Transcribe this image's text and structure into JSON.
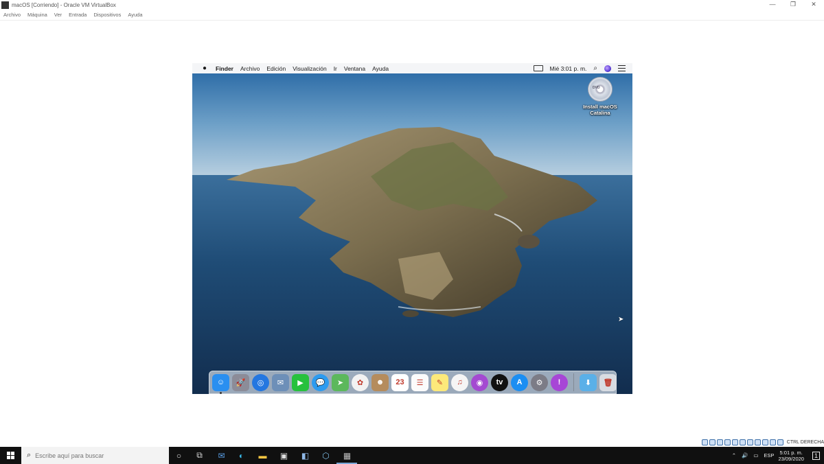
{
  "window": {
    "title": "macOS [Corriendo] - Oracle VM VirtualBox",
    "controls": {
      "minimize": "—",
      "restore": "❐",
      "close": "✕"
    }
  },
  "vbox_menu": [
    "Archivo",
    "Máquina",
    "Ver",
    "Entrada",
    "Dispositivos",
    "Ayuda"
  ],
  "mac": {
    "apple_icon": "apple-icon",
    "app_name": "Finder",
    "menus": [
      "Archivo",
      "Edición",
      "Visualización",
      "Ir",
      "Ventana",
      "Ayuda"
    ],
    "clock": "Mié 3:01 p. m.",
    "desktop_icon_label_1": "Install macOS",
    "desktop_icon_label_2": "Catalina",
    "dvd_text": "DVD",
    "dock": [
      {
        "name": "finder",
        "glyph": "☺",
        "color": "#2a8ff0"
      },
      {
        "name": "launchpad",
        "glyph": "🚀",
        "color": "#8c8c98"
      },
      {
        "name": "safari",
        "glyph": "◎",
        "color": "#2477e0"
      },
      {
        "name": "mail-stamp",
        "glyph": "✉",
        "color": "#6d8fb8"
      },
      {
        "name": "facetime",
        "glyph": "▶",
        "color": "#27c13d"
      },
      {
        "name": "messages",
        "glyph": "💬",
        "color": "#2d9bf0"
      },
      {
        "name": "maps",
        "glyph": "➤",
        "color": "#5cb85c"
      },
      {
        "name": "photos",
        "glyph": "✿",
        "color": "#f2f2f2"
      },
      {
        "name": "contacts",
        "glyph": "☻",
        "color": "#b58c5d"
      },
      {
        "name": "calendar",
        "glyph": "23",
        "color": "#ffffff"
      },
      {
        "name": "reminders",
        "glyph": "☰",
        "color": "#fbfbfb"
      },
      {
        "name": "notes",
        "glyph": "✎",
        "color": "#fde97a"
      },
      {
        "name": "music",
        "glyph": "♫",
        "color": "#f5f5f5"
      },
      {
        "name": "podcasts",
        "glyph": "◉",
        "color": "#a44ad1"
      },
      {
        "name": "apple-tv",
        "glyph": "tv",
        "color": "#111111"
      },
      {
        "name": "app-store",
        "glyph": "A",
        "color": "#1b8ef2"
      },
      {
        "name": "system-preferences",
        "glyph": "⚙",
        "color": "#7c7c86"
      },
      {
        "name": "feedback-assistant",
        "glyph": "!",
        "color": "#a746d6"
      }
    ],
    "dock_right": [
      {
        "name": "downloads-folder",
        "glyph": "⬇",
        "color": "#5ab0e8"
      },
      {
        "name": "trash",
        "glyph": "🗑",
        "color": "#d8dce2"
      }
    ]
  },
  "vbox_status": {
    "host_key": "CTRL DERECHA"
  },
  "taskbar": {
    "search_placeholder": "Escribe aquí para buscar",
    "language": "ESP",
    "time": "5:01 p. m.",
    "date": "23/09/2020",
    "notification_count": "1"
  },
  "colors": {
    "taskbar": "#101010",
    "accent": "#7aa7d8"
  }
}
